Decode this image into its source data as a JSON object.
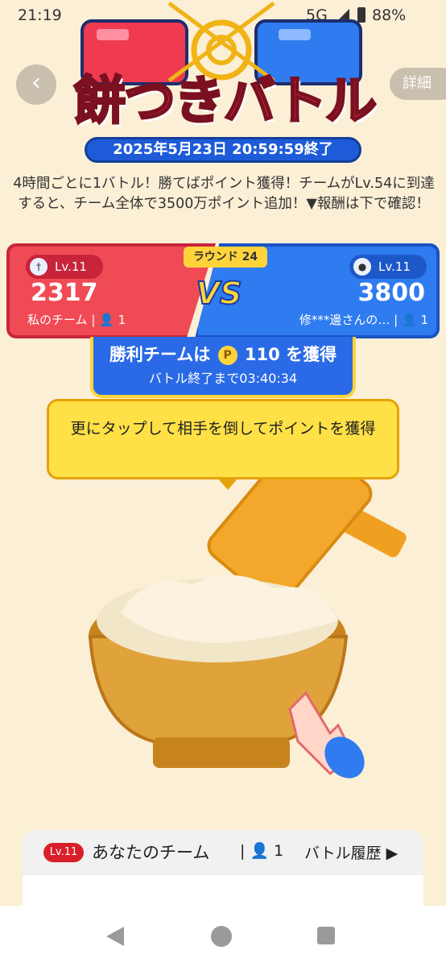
{
  "status": {
    "time": "21:19",
    "network": "5G",
    "battery": "88%"
  },
  "header": {
    "title": "餅つきバトル",
    "period": "2025年5月23日 20:59:59終了",
    "detail_label": "詳細",
    "back_icon": "‹"
  },
  "description": "4時間ごとに1バトル！勝てばポイント獲得！チームがLv.54に到達すると、チーム全体で3500万ポイント追加！▼報酬は下で確認！",
  "battle": {
    "round_label": "ラウンド 24",
    "vs": "VS",
    "my_team": {
      "level": "Lv.11",
      "score": "2317",
      "name": "私のチーム",
      "members": "1"
    },
    "opponent": {
      "level": "Lv.11",
      "score": "3800",
      "name": "修***邊さんの…",
      "members": "1"
    },
    "win_prefix": "勝利チームは",
    "win_points": "110",
    "win_suffix": "を獲得",
    "coin_symbol": "P",
    "countdown": "バトル終了まで03:40:34"
  },
  "tooltip": "更にタップして相手を倒してポイントを獲得",
  "team_card": {
    "level": "Lv.11",
    "title": "あなたのチーム",
    "members": "1",
    "history_label": "バトル履歴 ▶"
  },
  "colors": {
    "red": "#f04a55",
    "blue": "#2f7bf0",
    "yellow": "#ffd43b",
    "background": "#fbefd6"
  }
}
